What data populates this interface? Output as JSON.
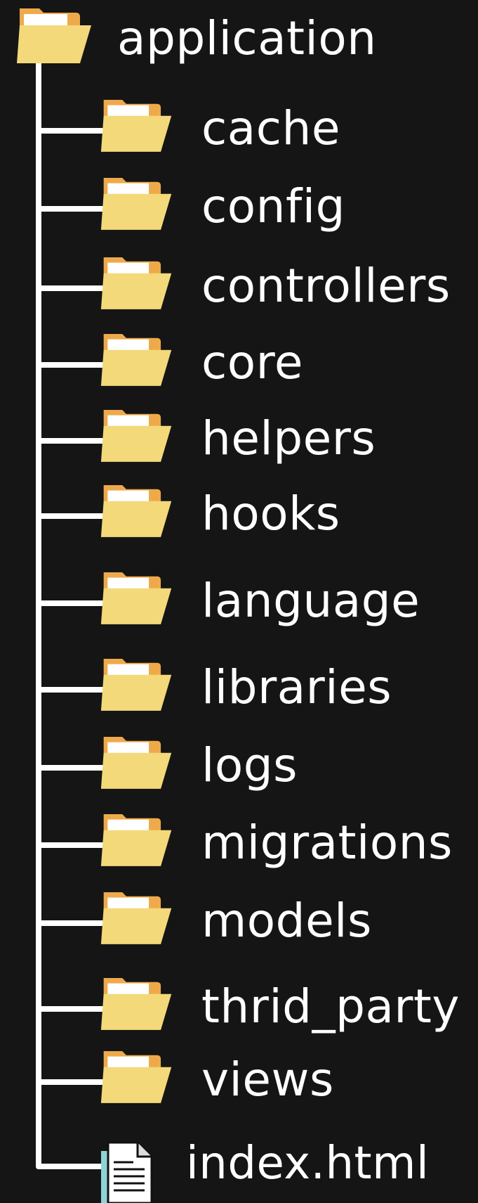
{
  "tree": {
    "root": {
      "name": "application",
      "icon": "folder-open-icon"
    },
    "children": [
      {
        "name": "cache",
        "icon": "folder-open-icon"
      },
      {
        "name": "config",
        "icon": "folder-open-icon"
      },
      {
        "name": "controllers",
        "icon": "folder-open-icon"
      },
      {
        "name": "core",
        "icon": "folder-open-icon"
      },
      {
        "name": "helpers",
        "icon": "folder-open-icon"
      },
      {
        "name": "hooks",
        "icon": "folder-open-icon"
      },
      {
        "name": "language",
        "icon": "folder-open-icon"
      },
      {
        "name": "libraries",
        "icon": "folder-open-icon"
      },
      {
        "name": "logs",
        "icon": "folder-open-icon"
      },
      {
        "name": "migrations",
        "icon": "folder-open-icon"
      },
      {
        "name": "models",
        "icon": "folder-open-icon"
      },
      {
        "name": "thrid_party",
        "icon": "folder-open-icon"
      },
      {
        "name": "views",
        "icon": "folder-open-icon"
      },
      {
        "name": "index.html",
        "icon": "file-document-icon"
      }
    ]
  },
  "colors": {
    "background": "#151515",
    "text": "#ffffff",
    "connector": "#ffffff",
    "folder_front": "#f3d97a",
    "folder_back": "#eeaa4a",
    "file_accent": "#8fd3d8"
  }
}
